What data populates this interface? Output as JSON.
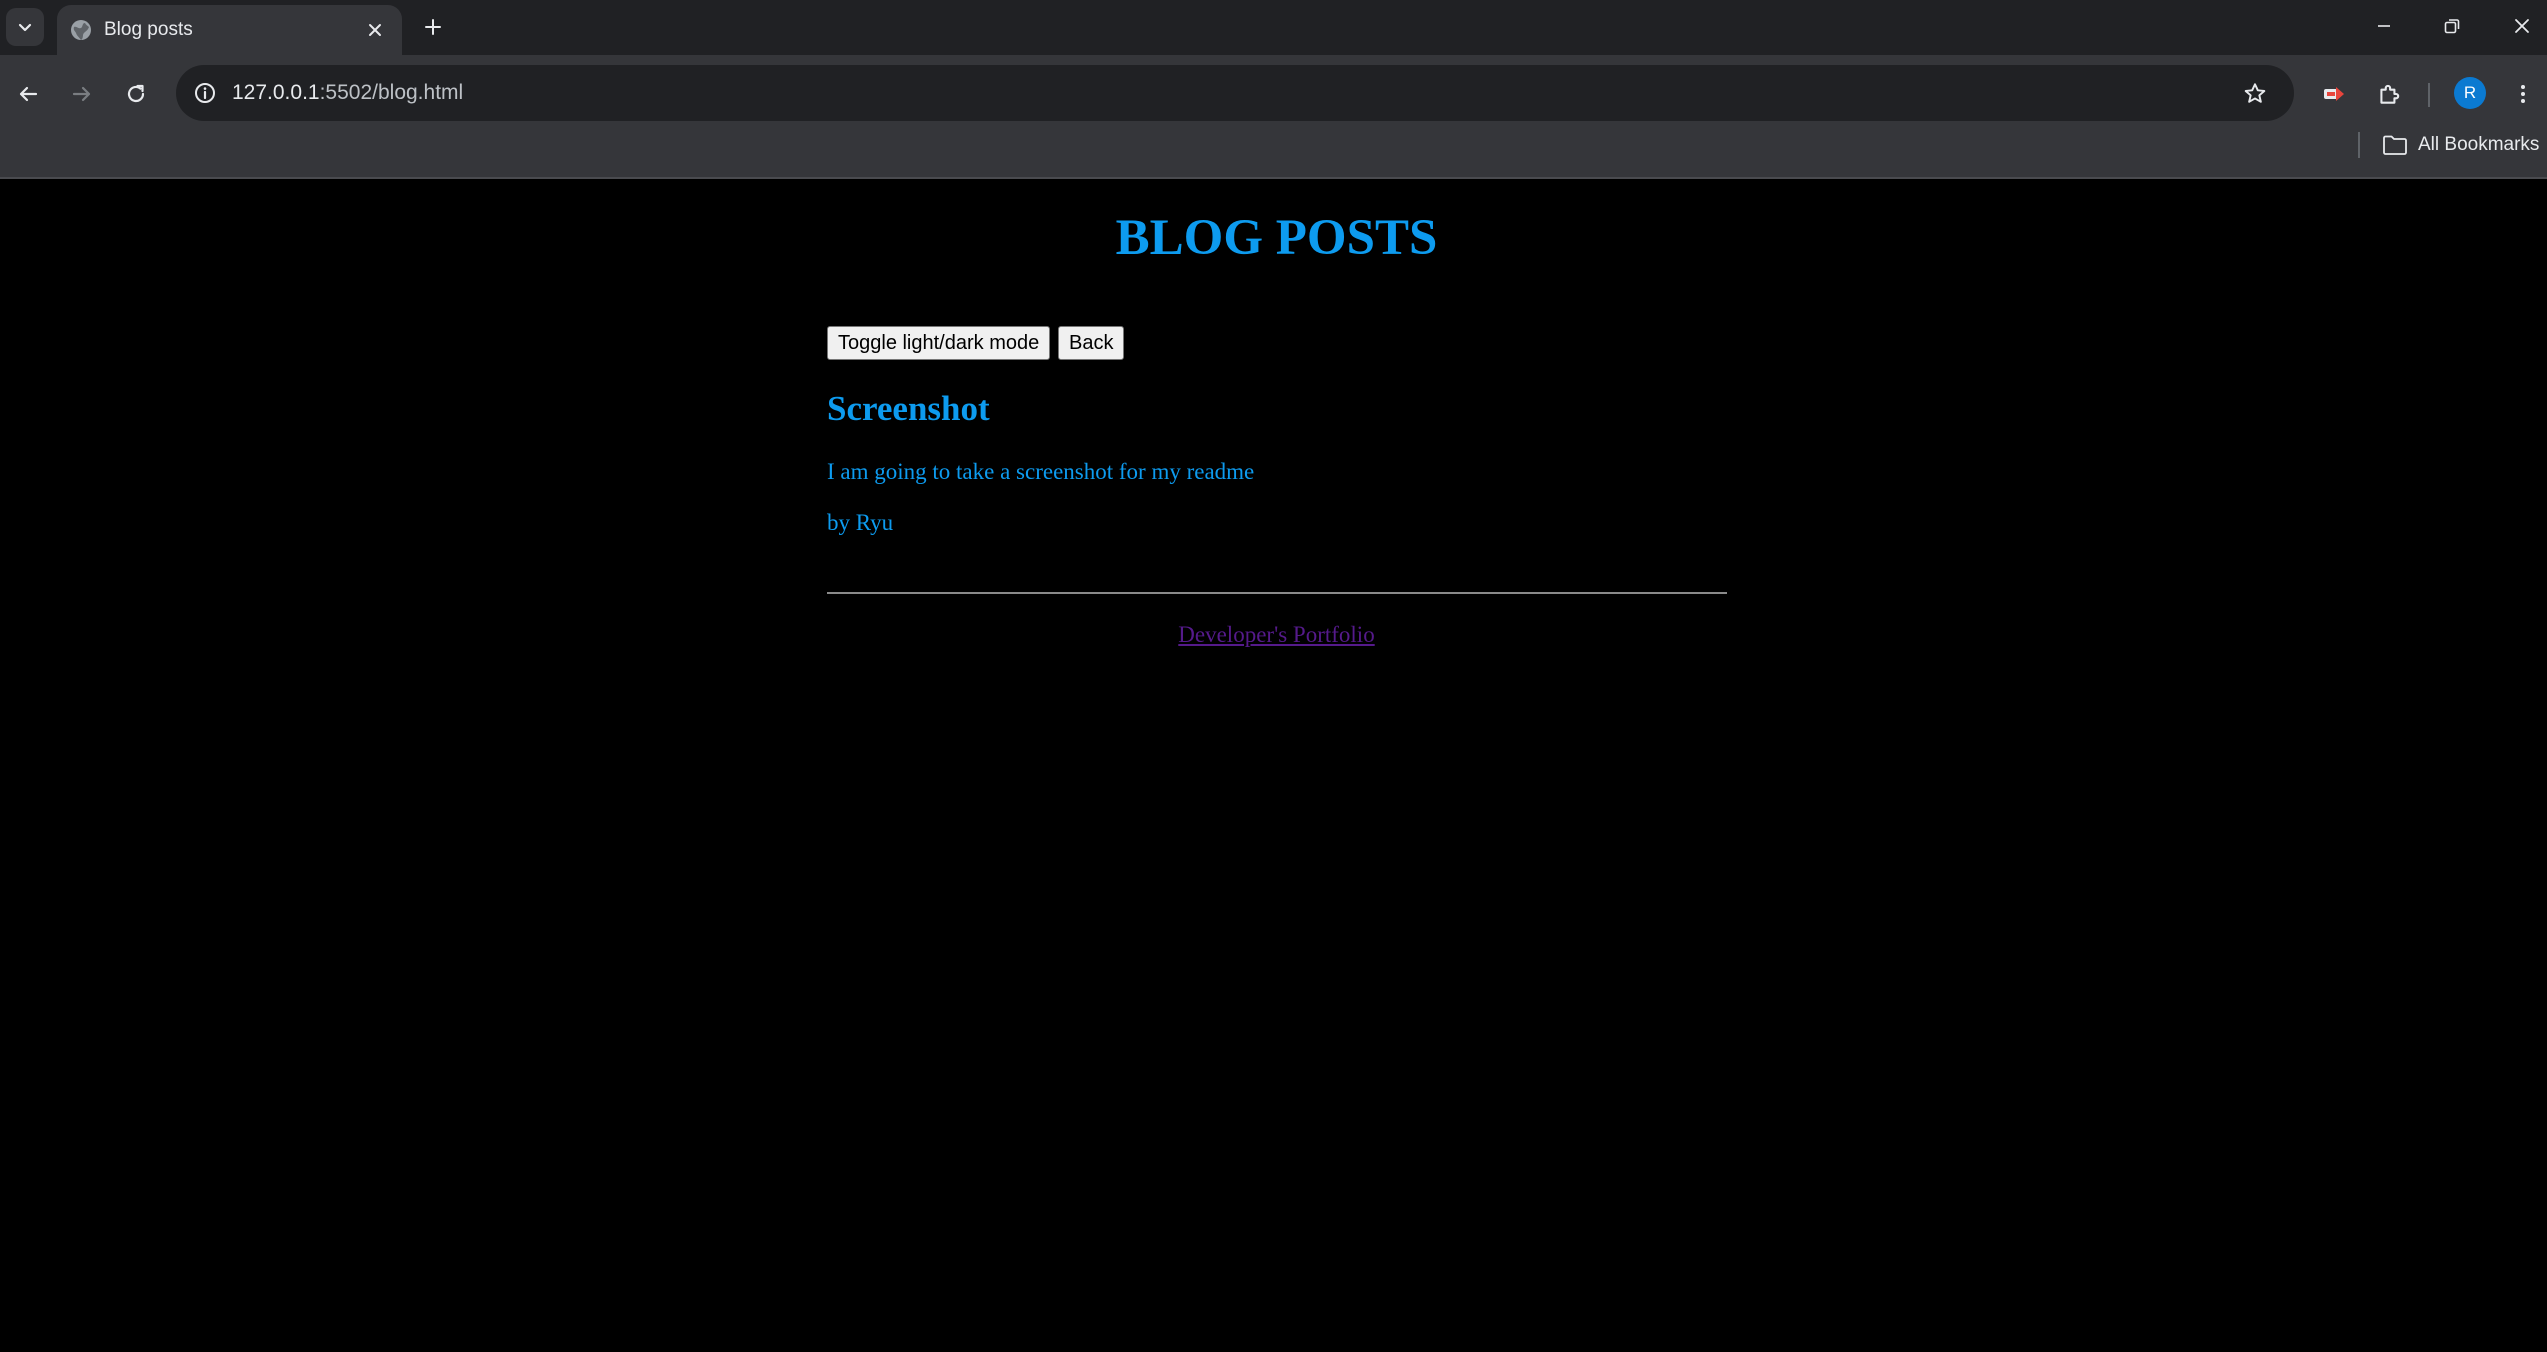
{
  "browser": {
    "tab": {
      "title": "Blog posts"
    },
    "address_bar": {
      "url_host": "127.0.0.1",
      "url_rest": ":5502/blog.html"
    },
    "profile_initial": "R",
    "bookmarks": {
      "all_bookmarks_label": "All Bookmarks"
    }
  },
  "page": {
    "title": "BLOG POSTS",
    "buttons": {
      "toggle_label": "Toggle light/dark mode",
      "back_label": "Back"
    },
    "posts": [
      {
        "title": "Screenshot",
        "body": "I am going to take a screenshot for my readme",
        "author": "by Ryu"
      }
    ],
    "footer": {
      "link_text": "Developer's Portfolio"
    }
  },
  "colors": {
    "accent_text": "#0d9bef",
    "page_background": "#000000",
    "visited_link": "#551a8b",
    "avatar": "#0b7ad1"
  },
  "icons": {
    "tab_search": "chevron-down-icon",
    "favicon": "globe-icon",
    "tab_close": "close-icon",
    "new_tab": "plus-icon",
    "back": "arrow-left-icon",
    "forward": "arrow-right-icon",
    "reload": "reload-icon",
    "site_info": "info-icon",
    "bookmark_star": "star-icon",
    "extension_red": "extension-icon",
    "extensions": "puzzle-icon",
    "menu": "kebab-menu-icon",
    "folder": "folder-icon"
  }
}
